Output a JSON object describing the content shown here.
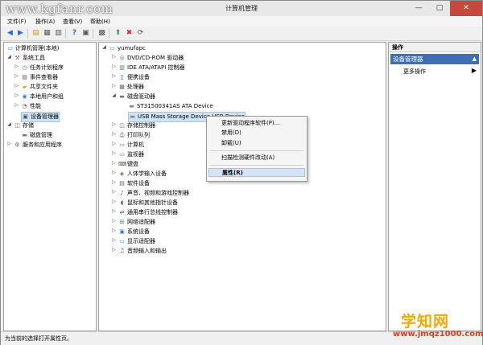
{
  "watermark": "www.kgfanr.com",
  "window": {
    "title": "计算机管理",
    "min": "—",
    "max": "□",
    "close": "✕"
  },
  "menu": [
    "文件(F)",
    "操作(A)",
    "查看(V)",
    "帮助(H)"
  ],
  "left_tree": [
    {
      "label": "计算机管理(本地)",
      "level": 0,
      "exp": "",
      "icon": "computer-icon"
    },
    {
      "label": "系统工具",
      "level": 1,
      "exp": "◢",
      "icon": "tools-icon"
    },
    {
      "label": "任务计划程序",
      "level": 2,
      "exp": "▷",
      "icon": "clock-icon"
    },
    {
      "label": "事件查看器",
      "level": 2,
      "exp": "▷",
      "icon": "event-icon"
    },
    {
      "label": "共享文件夹",
      "level": 2,
      "exp": "▷",
      "icon": "folder-icon"
    },
    {
      "label": "本地用户和组",
      "level": 2,
      "exp": "▷",
      "icon": "users-icon"
    },
    {
      "label": "性能",
      "level": 2,
      "exp": "▷",
      "icon": "performance-icon"
    },
    {
      "label": "设备管理器",
      "level": 2,
      "exp": "",
      "icon": "device-icon",
      "selected": true
    },
    {
      "label": "存储",
      "level": 1,
      "exp": "◢",
      "icon": "storage-icon"
    },
    {
      "label": "磁盘管理",
      "level": 2,
      "exp": "",
      "icon": "disk-icon"
    },
    {
      "label": "服务和应用程序",
      "level": 1,
      "exp": "▷",
      "icon": "services-icon"
    }
  ],
  "device_tree": [
    {
      "label": "yumufapc",
      "level": 0,
      "exp": "◢",
      "icon": "computer-icon"
    },
    {
      "label": "DVD/CD-ROM 驱动器",
      "level": 1,
      "exp": "▷",
      "icon": "dvd-icon"
    },
    {
      "label": "IDE ATA/ATAPI 控制器",
      "level": 1,
      "exp": "▷",
      "icon": "ide-icon"
    },
    {
      "label": "便携设备",
      "level": 1,
      "exp": "▷",
      "icon": "portable-icon"
    },
    {
      "label": "处理器",
      "level": 1,
      "exp": "▷",
      "icon": "cpu-icon"
    },
    {
      "label": "磁盘驱动器",
      "level": 1,
      "exp": "◢",
      "icon": "disk-icon"
    },
    {
      "label": "ST31500341AS ATA Device",
      "level": 2,
      "exp": "",
      "icon": "hdd-icon"
    },
    {
      "label": "USB Mass Storage Device USB Device",
      "level": 2,
      "exp": "",
      "icon": "hdd-icon",
      "selected": true
    },
    {
      "label": "存储控制器",
      "level": 1,
      "exp": "▷",
      "icon": "storage-ctrl-icon"
    },
    {
      "label": "打印队列",
      "level": 1,
      "exp": "▷",
      "icon": "printer-icon"
    },
    {
      "label": "计算机",
      "level": 1,
      "exp": "▷",
      "icon": "computer-icon"
    },
    {
      "label": "监视器",
      "level": 1,
      "exp": "▷",
      "icon": "monitor-icon"
    },
    {
      "label": "键盘",
      "level": 1,
      "exp": "▷",
      "icon": "keyboard-icon"
    },
    {
      "label": "人体学输入设备",
      "level": 1,
      "exp": "▷",
      "icon": "hid-icon"
    },
    {
      "label": "软件设备",
      "level": 1,
      "exp": "▷",
      "icon": "software-icon"
    },
    {
      "label": "声音、视频和游戏控制器",
      "level": 1,
      "exp": "▷",
      "icon": "sound-icon"
    },
    {
      "label": "鼠标和其他指针设备",
      "level": 1,
      "exp": "▷",
      "icon": "mouse-icon"
    },
    {
      "label": "通用串行总线控制器",
      "level": 1,
      "exp": "▷",
      "icon": "usb-icon"
    },
    {
      "label": "网络适配器",
      "level": 1,
      "exp": "▷",
      "icon": "network-icon"
    },
    {
      "label": "系统设备",
      "level": 1,
      "exp": "▷",
      "icon": "system-icon"
    },
    {
      "label": "显示适配器",
      "level": 1,
      "exp": "▷",
      "icon": "display-icon"
    },
    {
      "label": "音频输入和输出",
      "level": 1,
      "exp": "▷",
      "icon": "audio-icon"
    }
  ],
  "context_menu": {
    "update": "更新驱动程序软件(P)...",
    "disable": "禁用(D)",
    "uninstall": "卸载(U)",
    "scan": "扫描检测硬件改动(A)",
    "properties": "属性(R)"
  },
  "actions": {
    "header": "操作",
    "section": "设备管理器",
    "section_arrow": "▲",
    "more": "更多操作",
    "more_arrow": "▶"
  },
  "status": "为当前的选择打开属性页。",
  "branding": {
    "main": "学知网",
    "url": "www.jmqz1000.com"
  }
}
